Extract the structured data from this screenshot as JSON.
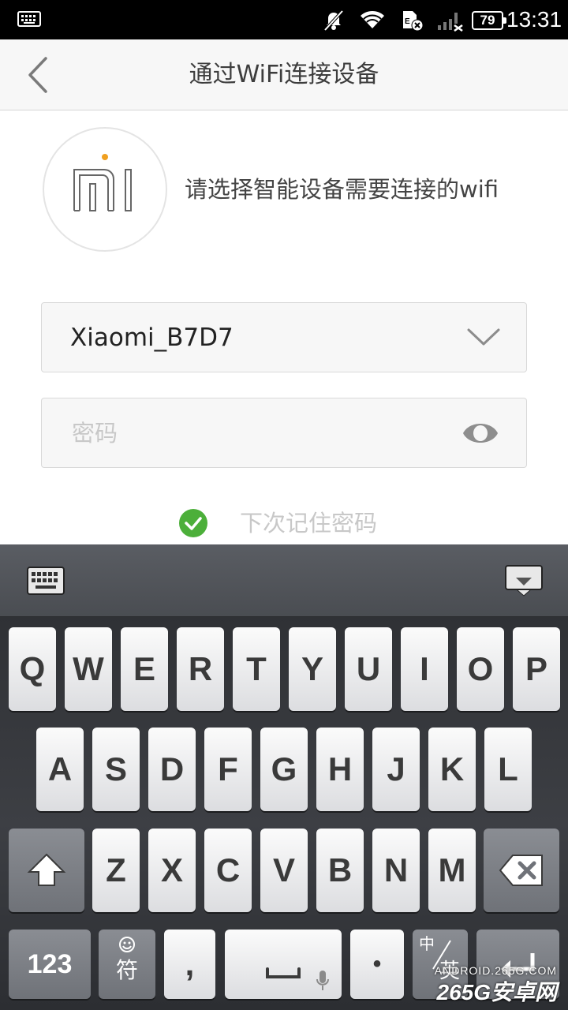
{
  "status_bar": {
    "battery": "79",
    "time": "13:31"
  },
  "header": {
    "title": "通过WiFi连接设备"
  },
  "main": {
    "instruction": "请选择智能设备需要连接的wifi",
    "wifi_select": {
      "value": "Xiaomi_B7D7"
    },
    "password": {
      "placeholder": "密码",
      "value": ""
    },
    "remember": {
      "label": "下次记住密码",
      "checked": true
    }
  },
  "keyboard": {
    "row1": [
      "Q",
      "W",
      "E",
      "R",
      "T",
      "Y",
      "U",
      "I",
      "O",
      "P"
    ],
    "row2": [
      "A",
      "S",
      "D",
      "F",
      "G",
      "H",
      "J",
      "K",
      "L"
    ],
    "row3": [
      "Z",
      "X",
      "C",
      "V",
      "B",
      "N",
      "M"
    ],
    "num_label": "123",
    "symbol_label": "符",
    "comma_label": ",",
    "period_label": "•",
    "lang_zh": "中",
    "lang_en": "英"
  },
  "watermark": {
    "line1": "ANDROID.265G.COM",
    "line2": "265G安卓网"
  },
  "colors": {
    "status_bar_bg": "#000000",
    "title_bar_bg": "#f7f7f7",
    "check_green": "#4caf3a",
    "mi_orange": "#f0a020",
    "keyboard_bg": "#3a3c41"
  }
}
